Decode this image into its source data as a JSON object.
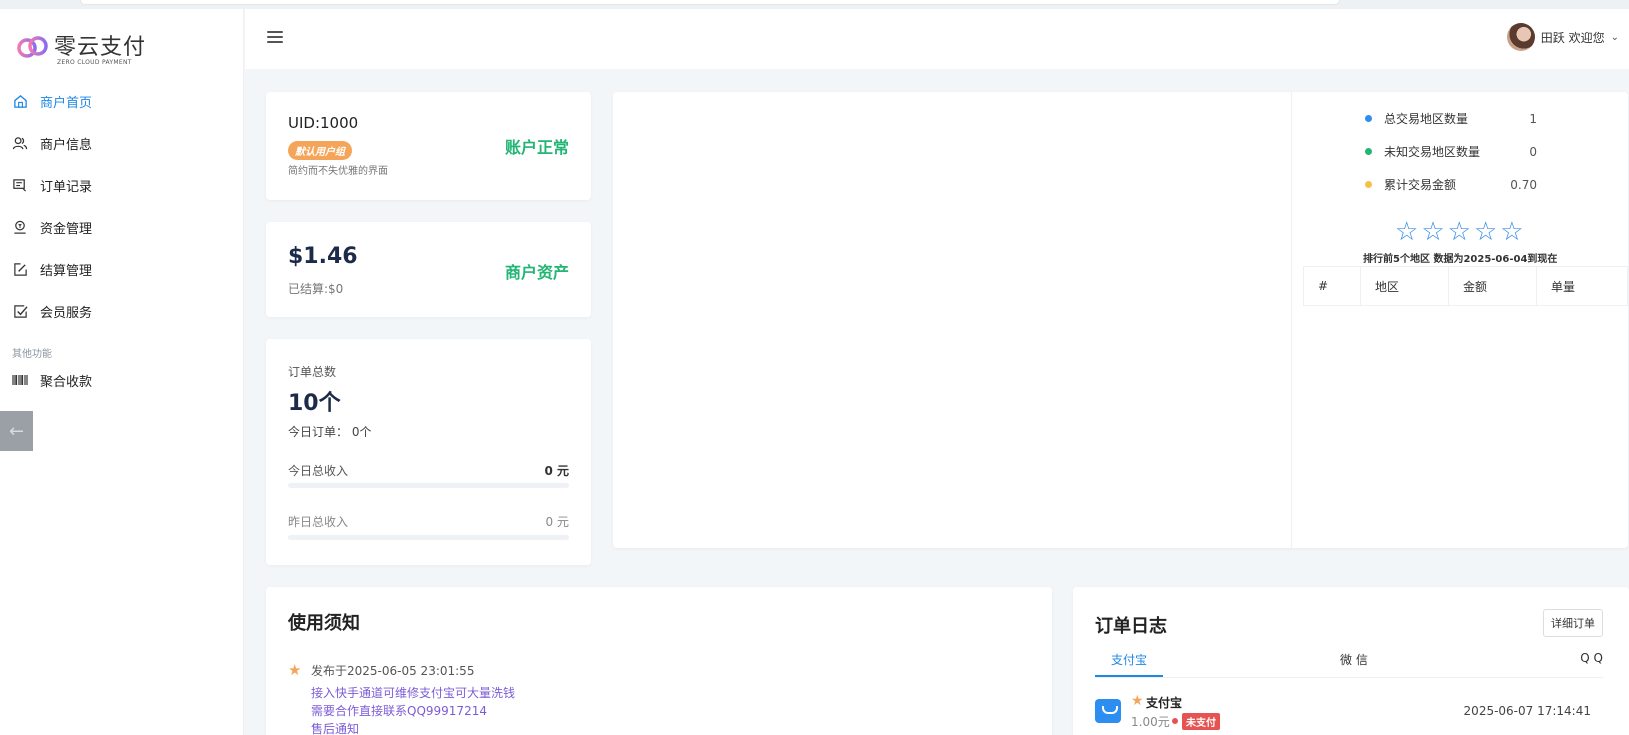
{
  "brand": {
    "title": "零云支付",
    "subtitle": "ZERO CLOUD PAYMENT"
  },
  "sidebar": {
    "items": [
      {
        "label": "商户首页",
        "icon": "home-icon",
        "active": true
      },
      {
        "label": "商户信息",
        "icon": "users-icon"
      },
      {
        "label": "订单记录",
        "icon": "receipt-icon"
      },
      {
        "label": "资金管理",
        "icon": "wallet-icon"
      },
      {
        "label": "结算管理",
        "icon": "edit-icon"
      },
      {
        "label": "会员服务",
        "icon": "checkbox-icon"
      }
    ],
    "section_label": "其他功能",
    "extra_items": [
      {
        "label": "聚合收款",
        "icon": "barcode-icon"
      }
    ]
  },
  "header": {
    "user_greeting": "田跃 欢迎您"
  },
  "account": {
    "uid": "UID:1000",
    "group_badge": "默认用户组",
    "slogan": "简约而不失优雅的界面",
    "status": "账户正常"
  },
  "assets": {
    "balance": "$1.46",
    "settled": "已结算:$0",
    "label": "商户资产"
  },
  "orders": {
    "label": "订单总数",
    "total": "10个",
    "today_orders": "今日订单： 0个",
    "today_income_label": "今日总收入",
    "today_income": "0 元",
    "yesterday_income_label": "昨日总收入",
    "yesterday_income": "0 元"
  },
  "region_stats": {
    "items": [
      {
        "label": "总交易地区数量",
        "value": "1",
        "dot_color": "#2b8ef0"
      },
      {
        "label": "未知交易地区数量",
        "value": "0",
        "dot_color": "#22b573"
      },
      {
        "label": "累计交易金额",
        "value": "0.70",
        "dot_color": "#f5c242"
      }
    ],
    "rank_text": "排行前5个地区 数据为2025-06-04到现在",
    "table_headers": [
      "#",
      "地区",
      "金额",
      "单量"
    ]
  },
  "notice": {
    "title": "使用须知",
    "date": "发布于2025-06-05 23:01:55",
    "lines": [
      "接入快手通道可维修支付宝可大量洗钱",
      "需要合作直接联系QQ99917214",
      "售后通知"
    ]
  },
  "order_log": {
    "title": "订单日志",
    "detail_button": "详细订单",
    "tabs": [
      "支付宝",
      "微 信",
      "Q Q"
    ],
    "entry": {
      "name": "支付宝",
      "amount": "1.00元",
      "status": "未支付",
      "time": "2025-06-07 17:14:41"
    }
  },
  "colors": {
    "accent": "#1e88e5",
    "success": "#22b573",
    "warning": "#f5a55a",
    "danger": "#e55353"
  }
}
